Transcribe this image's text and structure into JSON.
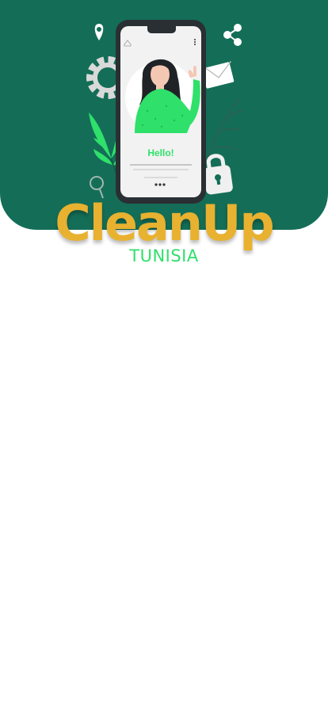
{
  "illustration": {
    "greeting": "Hello!"
  },
  "brand": {
    "title": "CleanUp",
    "subtitle": "TUNISIA"
  },
  "colors": {
    "hero_background": "#146e57",
    "title": "#e8b130",
    "subtitle": "#2fe06a",
    "accent_green": "#2fe06a"
  }
}
